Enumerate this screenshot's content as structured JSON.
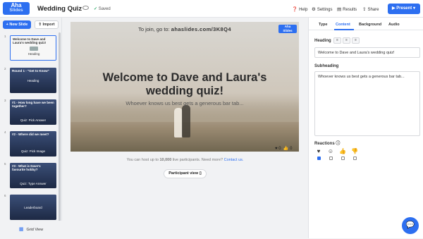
{
  "app": {
    "logo_top": "Aha",
    "logo_bottom": "Slides",
    "quiz_title": "Wedding Quiz",
    "saved_status": "Saved"
  },
  "toolbar": {
    "help": "Help",
    "settings": "Settings",
    "results": "Results",
    "share": "Share",
    "present": "Present"
  },
  "left": {
    "new_slide": "+ New Slide",
    "import": "Import",
    "grid_view": "Grid View",
    "slides": [
      {
        "num": "1",
        "title": "Welcome to Dave and Laura's wedding quiz!",
        "kind": "Heading",
        "selected": true
      },
      {
        "num": "2",
        "title": "Round 1 - \"Get to Know\"",
        "kind": "Heading",
        "selected": false
      },
      {
        "num": "3",
        "title": "#1 - How long have we been together?",
        "kind": "Quiz: Pick Answer",
        "selected": false
      },
      {
        "num": "4",
        "title": "#2 - Where did we meet?",
        "kind": "Quiz: Pick Image",
        "selected": false
      },
      {
        "num": "5",
        "title": "#3 - What is Dave's favourite hobby?",
        "kind": "Quiz: Type Answer",
        "selected": false
      },
      {
        "num": "6",
        "title": "",
        "kind": "Leaderboard",
        "selected": false
      }
    ]
  },
  "slide": {
    "join_prefix": "To join, go to:",
    "join_url": "ahaslides.com/3K8Q4",
    "logo_top": "Aha",
    "logo_bottom": "Slides",
    "heading": "Welcome to Dave and Laura's wedding quiz!",
    "subheading": "Whoever knows us best gets a generous bar tab...",
    "reaction_heart_count": "0",
    "reaction_like_count": "0"
  },
  "canvas": {
    "host_note_prefix": "You can host up to",
    "host_note_limit": "10,000",
    "host_note_suffix": "live participants. Need more?",
    "contact_link": "Contact us.",
    "participant_view": "Participant view"
  },
  "right": {
    "tabs": [
      "Type",
      "Content",
      "Background",
      "Audio"
    ],
    "active_tab": "Content",
    "heading_label": "Heading",
    "heading_value": "Welcome to Dave and Laura's wedding quiz!",
    "subheading_label": "Subheading",
    "subheading_value": "Whoever knows us best gets a generous bar tab...",
    "reactions_label": "Reactions",
    "reactions": [
      {
        "icon": "heart-icon",
        "checked": true
      },
      {
        "icon": "laugh-icon",
        "checked": false
      },
      {
        "icon": "thumbs-up-icon",
        "checked": false
      },
      {
        "icon": "thumbs-down-icon",
        "checked": false
      }
    ]
  },
  "colors": {
    "accent": "#2d6ff0",
    "panel_bg": "#f1f2f4"
  }
}
